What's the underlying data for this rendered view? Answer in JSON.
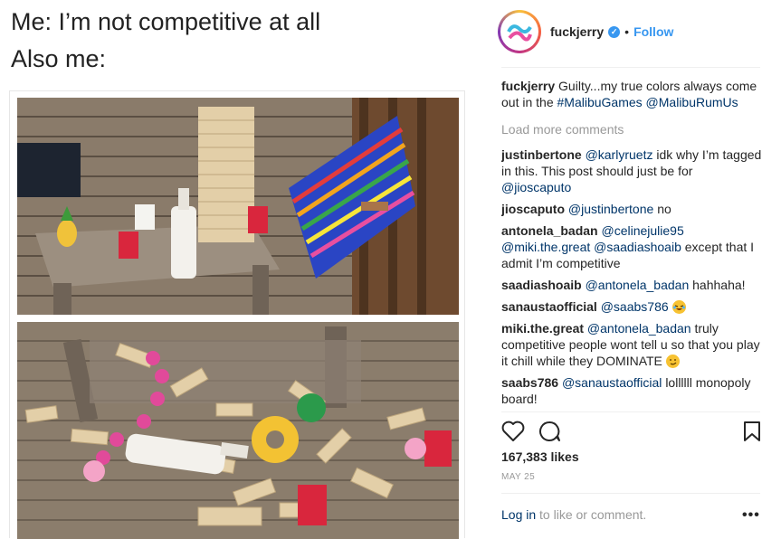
{
  "meme": {
    "line1": "Me: I’m not competitive at all",
    "line2": "Also me:"
  },
  "post": {
    "username": "fuckjerry",
    "follow_label": "Follow",
    "separator": "•",
    "caption": {
      "user": "fuckjerry",
      "text": "Guilty...my true colors always come out in the",
      "hashtag": "#MalibuGames",
      "mention": "@MalibuRumUs"
    },
    "load_more": "Load more comments",
    "comments": [
      {
        "user": "justinbertone",
        "mention": "@karlyruetz",
        "text": "idk why I’m tagged in this. This post should just be for",
        "mention2": "@jioscaputo"
      },
      {
        "user": "jioscaputo",
        "mention": "@justinbertone",
        "text": "no"
      },
      {
        "user": "antonela_badan",
        "mention": "@celinejulie95",
        "mention2": "@miki.the.great",
        "mention3": "@saadiashoaib",
        "text": "except that I admit I’m competitive"
      },
      {
        "user": "saadiashoaib",
        "mention": "@antonela_badan",
        "text": "hahhaha!"
      },
      {
        "user": "sanaustaofficial",
        "mention": "@saabs786",
        "emoji": "laughing-face"
      },
      {
        "user": "miki.the.great",
        "mention": "@antonela_badan",
        "text": "truly competitive people wont tell u so that you play it chill while they DOMINATE",
        "emoji": "smirk-face"
      },
      {
        "user": "saabs786",
        "mention": "@sanaustaofficial",
        "text": "lollllll monopoly board!"
      }
    ],
    "likes": "167,383 likes",
    "date": "MAY 25",
    "login_link": "Log in",
    "login_rest": " to like or comment.",
    "more": "•••"
  },
  "icons": {
    "like": "heart-icon",
    "comment": "comment-bubble-icon",
    "save": "bookmark-icon",
    "verified": "verified-badge-icon"
  },
  "colors": {
    "link": "#003569",
    "accent_blue": "#3897f0",
    "muted": "#999999"
  }
}
